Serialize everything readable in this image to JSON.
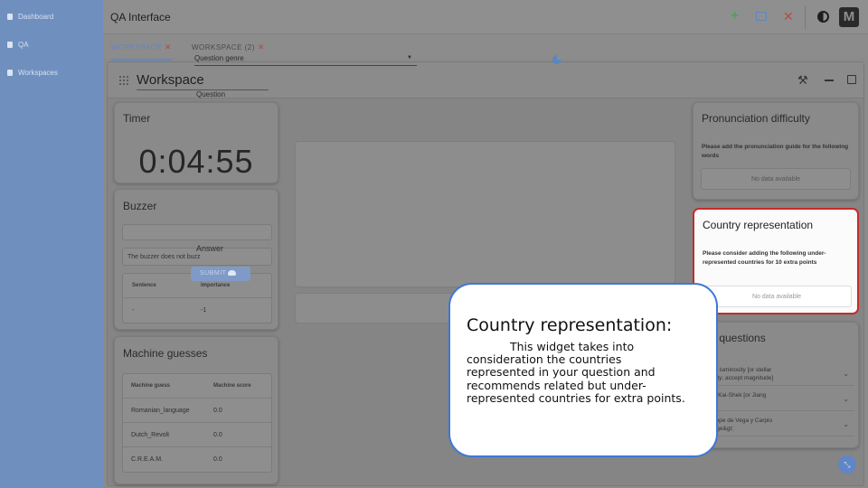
{
  "sidebar": {
    "items": [
      {
        "label": "Dashboard",
        "icon": "user-icon"
      },
      {
        "label": "QA",
        "icon": "document-icon"
      },
      {
        "label": "Workspaces",
        "icon": "grid-icon"
      }
    ]
  },
  "topbar": {
    "title": "QA Interface",
    "icons": [
      "plus-icon",
      "copy-icon",
      "close-icon",
      "theme-toggle-icon",
      "logo-icon"
    ]
  },
  "tabs": [
    {
      "label": "WORKSPACE",
      "active": true
    },
    {
      "label": "WORKSPACE (2)",
      "active": false
    }
  ],
  "workspace": {
    "title": "Workspace"
  },
  "timer": {
    "title": "Timer",
    "value": "0:04:55"
  },
  "buzzer": {
    "title": "Buzzer",
    "status": "The buzzer does not buzz",
    "table": {
      "headers": [
        "Sentence",
        "Importance"
      ],
      "rows": [
        [
          "-",
          "-1"
        ]
      ]
    }
  },
  "machine_guesses": {
    "title": "Machine guesses",
    "headers": [
      "Machine guess",
      "Machine score"
    ],
    "rows": [
      [
        "Romanian_language",
        "0.0"
      ],
      [
        "Dutch_Revolt",
        "0.0"
      ],
      [
        "C.R.E.A.M.",
        "0.0"
      ]
    ]
  },
  "question_editor": {
    "genre_placeholder": "Question genre",
    "question_label": "Question",
    "answer_label": "Answer",
    "submit_label": "SUBMIT"
  },
  "pronunciation": {
    "title": "Pronunciation difficulty",
    "text": "Please add the pronunciation guide for the following words",
    "nodata": "No data available"
  },
  "country": {
    "title": "Country representation",
    "text": "Please consider adding the following under-represented countries for 10 extra points",
    "nodata": "No data available"
  },
  "similar": {
    "title": "ilar questions",
    "items": [
      "tellar luminosity [or stellar\ninosity; accept magnitude]",
      "iang Kai-Shek [or Jiang\nshi]",
      "lix Lope de Vega y Carpio\n;Droge&gt;"
    ]
  },
  "tooltip": {
    "title": "Country representation:",
    "body": "This widget takes into consideration the countries represented in your question and recommends related but under-represented countries for extra points."
  },
  "colors": {
    "accent": "#5f86c6",
    "close": "#b94a45",
    "highlight_border": "#c42b2b",
    "tooltip_border": "#3f77d6"
  }
}
